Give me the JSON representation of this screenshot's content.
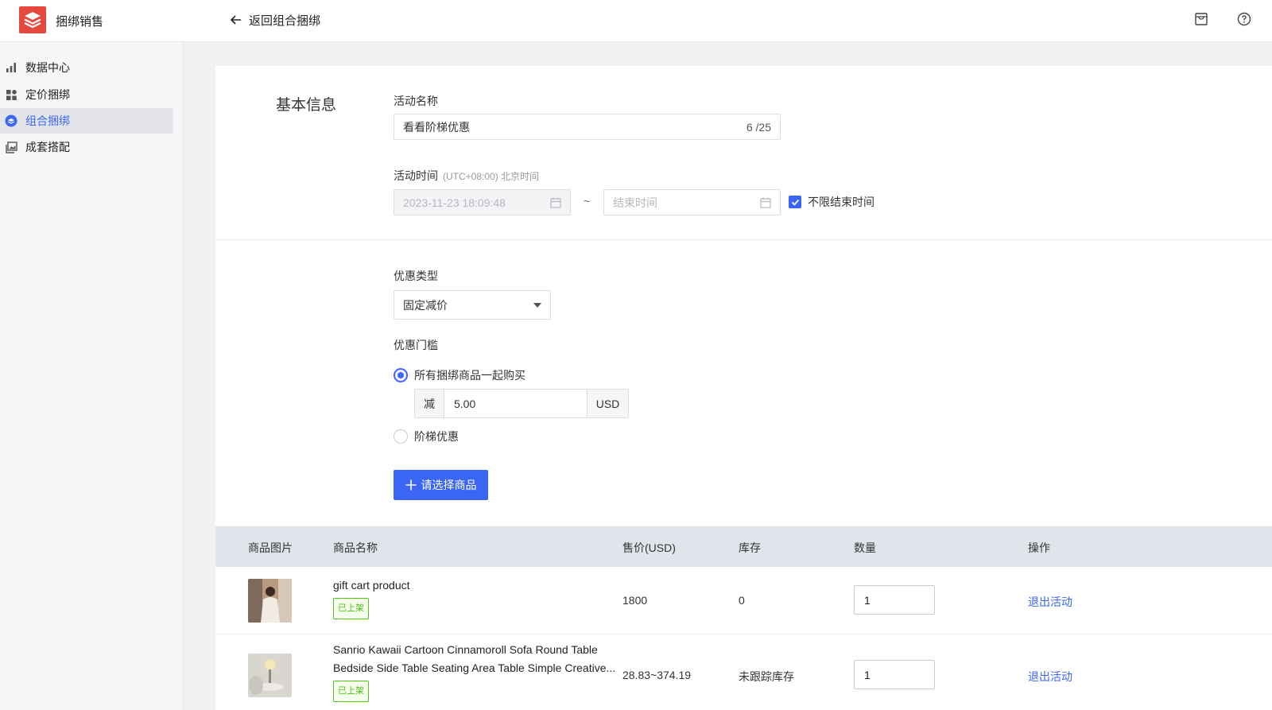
{
  "header": {
    "app_title": "捆绑销售",
    "back_label": "返回组合捆绑"
  },
  "sidebar": {
    "items": [
      {
        "label": "数据中心",
        "icon": "bar-chart-icon"
      },
      {
        "label": "定价捆绑",
        "icon": "grid-icon"
      },
      {
        "label": "组合捆绑",
        "icon": "layers-icon",
        "active": true
      },
      {
        "label": "成套搭配",
        "icon": "image-stack-icon"
      }
    ]
  },
  "form": {
    "section_title": "基本信息",
    "name_label": "活动名称",
    "name_value": "看看阶梯优惠",
    "name_counter": "6 /25",
    "time_label": "活动时间",
    "time_hint": "(UTC+08:00) 北京时间",
    "start_time": "2023-11-23 18:09:48",
    "tilde": "~",
    "end_placeholder": "结束时间",
    "no_end_label": "不限结束时间",
    "no_end_checked": true,
    "discount_type_label": "优惠类型",
    "discount_type_value": "固定减价",
    "threshold_label": "优惠门槛",
    "option_all": "所有捆绑商品一起购买",
    "option_tier": "阶梯优惠",
    "minus_prefix": "减",
    "amount": "5.00",
    "currency": "USD",
    "select_products_button": "请选择商品"
  },
  "table": {
    "headers": [
      "商品图片",
      "商品名称",
      "售价(USD)",
      "库存",
      "数量",
      "操作"
    ],
    "rows": [
      {
        "name": "gift cart product",
        "status": "已上架",
        "price": "1800",
        "stock": "0",
        "qty": "1",
        "action": "退出活动"
      },
      {
        "name": "Sanrio Kawaii Cartoon Cinnamoroll Sofa Round Table Bedside Side Table Seating Area Table Simple Creative...",
        "status": "已上架",
        "price": "28.83~374.19",
        "stock": "未跟踪库存",
        "qty": "1",
        "action": "退出活动"
      }
    ]
  },
  "colors": {
    "accent": "#3b66f5",
    "brand": "#e5483d",
    "success": "#52c41a"
  }
}
